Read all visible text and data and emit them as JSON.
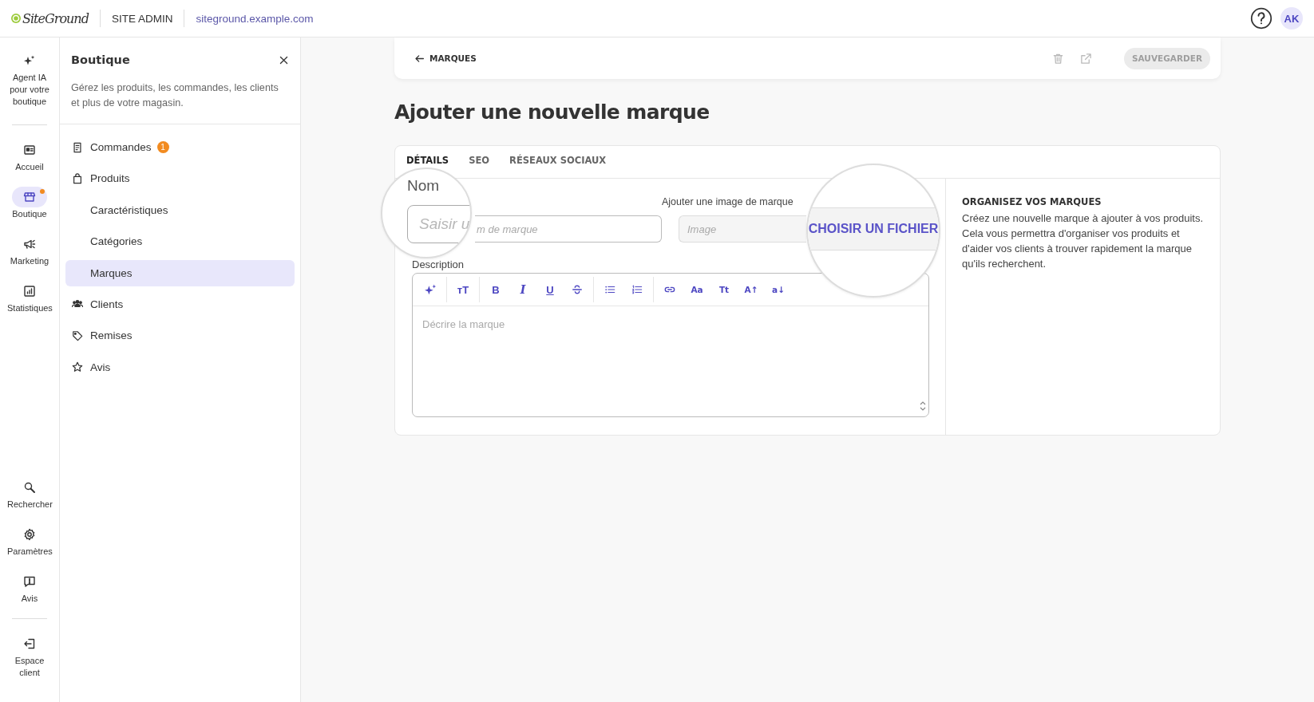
{
  "topbar": {
    "logo": "SiteGround",
    "section": "SITE ADMIN",
    "domain": "siteground.example.com",
    "avatar": "AK"
  },
  "rail": {
    "top": [
      {
        "label": "Agent IA pour votre boutique",
        "selected": false,
        "notification": false
      },
      {
        "label": "Accueil",
        "selected": false,
        "notification": false
      },
      {
        "label": "Boutique",
        "selected": true,
        "notification": true
      },
      {
        "label": "Marketing",
        "selected": false,
        "notification": false
      },
      {
        "label": "Statistiques",
        "selected": false,
        "notification": false
      }
    ],
    "bottom": [
      {
        "label": "Rechercher",
        "selected": false,
        "notification": false
      },
      {
        "label": "Paramètres",
        "selected": false,
        "notification": false
      },
      {
        "label": "Avis",
        "selected": false,
        "notification": false
      },
      {
        "label": "Espace client",
        "selected": false,
        "notification": false
      }
    ]
  },
  "sidebar": {
    "title": "Boutique",
    "description": "Gérez les produits, les commandes, les clients et plus de votre magasin.",
    "items": [
      {
        "kind": "main",
        "label": "Commandes",
        "badge": "1",
        "selected": false
      },
      {
        "kind": "main",
        "label": "Produits",
        "selected": false
      },
      {
        "kind": "sub",
        "label": "Caractéristiques",
        "selected": false
      },
      {
        "kind": "sub",
        "label": "Catégories",
        "selected": false
      },
      {
        "kind": "sub",
        "label": "Marques",
        "selected": true
      },
      {
        "kind": "main",
        "label": "Clients",
        "selected": false
      },
      {
        "kind": "main",
        "label": "Remises",
        "selected": false
      },
      {
        "kind": "main",
        "label": "Avis",
        "selected": false
      }
    ]
  },
  "main": {
    "back_link": "MARQUES",
    "save_button": {
      "label": "SAUVEGARDER",
      "disabled": true
    },
    "title": "Ajouter une nouvelle marque",
    "tabs": [
      {
        "label": "DÉTAILS",
        "selected": true
      },
      {
        "label": "SEO",
        "selected": false
      },
      {
        "label": "RÉSEAUX SOCIAUX",
        "selected": false
      }
    ],
    "name_field": {
      "placeholder": "m de marque"
    },
    "image_field": {
      "label": "Ajouter une image de marque",
      "placeholder": "Image"
    },
    "magnifiers": [
      {
        "kind": "name",
        "label": "Nom",
        "text": "Saisir u"
      },
      {
        "kind": "button",
        "text": "CHOISIR UN FICHIER"
      }
    ],
    "description": {
      "label": "Description",
      "placeholder": "Décrire la marque",
      "toolbar": [
        [
          {
            "kind": "icon"
          }
        ],
        [
          {
            "kind": "text",
            "label": "ᴛT"
          }
        ],
        [
          {
            "kind": "text",
            "label": "B"
          },
          {
            "kind": "text",
            "label": "I"
          },
          {
            "kind": "text",
            "label": "U"
          },
          {
            "kind": "icon"
          }
        ],
        [
          {
            "kind": "icon"
          },
          {
            "kind": "icon"
          }
        ],
        [
          {
            "kind": "icon"
          },
          {
            "kind": "text",
            "label": "Aa"
          },
          {
            "kind": "text",
            "label": "Tt"
          },
          {
            "kind": "text",
            "label": "A↑"
          },
          {
            "kind": "text",
            "label": "a↓"
          }
        ]
      ]
    },
    "info": {
      "heading": "ORGANISEZ VOS MARQUES",
      "text": "Créez une nouvelle marque à ajouter à vos produits. Cela vous permettra d'organiser vos produits et d'aider vos clients à trouver rapidement la marque qu'ils recherchent."
    }
  }
}
